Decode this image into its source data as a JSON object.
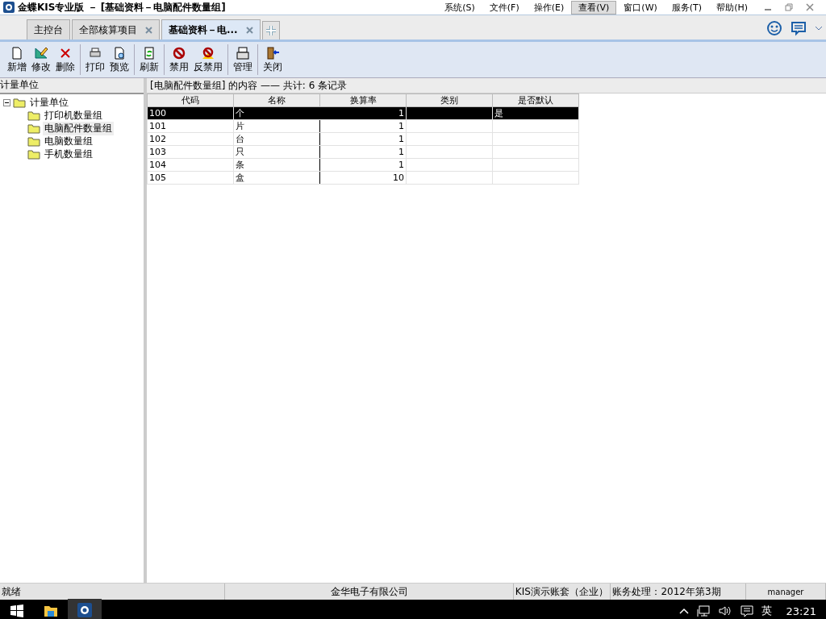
{
  "window": {
    "title": "金蝶KIS专业版 － [基础资料－电脑配件数量组]"
  },
  "menu": [
    {
      "label": "系统(S)",
      "selected": false
    },
    {
      "label": "文件(F)",
      "selected": false
    },
    {
      "label": "操作(E)",
      "selected": false
    },
    {
      "label": "查看(V)",
      "selected": true
    },
    {
      "label": "窗口(W)",
      "selected": false
    },
    {
      "label": "服务(T)",
      "selected": false
    },
    {
      "label": "帮助(H)",
      "selected": false
    }
  ],
  "tabs": [
    {
      "label": "主控台",
      "selected": false,
      "closable": false
    },
    {
      "label": "全部核算项目",
      "selected": false,
      "closable": true
    },
    {
      "label": "基础资料－电...",
      "selected": true,
      "closable": true
    }
  ],
  "toolbar_groups": [
    [
      {
        "label": "新增",
        "kind": "new"
      },
      {
        "label": "修改",
        "kind": "edit"
      },
      {
        "label": "删除",
        "kind": "delete"
      }
    ],
    [
      {
        "label": "打印",
        "kind": "print"
      },
      {
        "label": "预览",
        "kind": "preview"
      }
    ],
    [
      {
        "label": "刷新",
        "kind": "refresh"
      }
    ],
    [
      {
        "label": "禁用",
        "kind": "ban"
      },
      {
        "label": "反禁用",
        "kind": "unban"
      }
    ],
    [
      {
        "label": "管理",
        "kind": "manage"
      }
    ],
    [
      {
        "label": "关闭",
        "kind": "close"
      }
    ]
  ],
  "sidebar": {
    "title": "计量单位",
    "tree": [
      {
        "label": "计量单位",
        "expanded": true,
        "selected": false,
        "children": [
          {
            "label": "打印机数量组",
            "selected": false
          },
          {
            "label": "电脑配件数量组",
            "selected": true
          },
          {
            "label": "电脑数量组",
            "selected": false
          },
          {
            "label": "手机数量组",
            "selected": false
          }
        ]
      }
    ]
  },
  "content": {
    "header": "[电脑配件数量组] 的内容 —— 共计: 6 条记录",
    "columns": [
      "代码",
      "名称",
      "换算率",
      "类别",
      "是否默认"
    ],
    "rows": [
      {
        "cells": [
          "100",
          "个",
          "1",
          "",
          "是"
        ],
        "selected": true
      },
      {
        "cells": [
          "101",
          "片",
          "1",
          "",
          ""
        ],
        "selected": false
      },
      {
        "cells": [
          "102",
          "台",
          "1",
          "",
          ""
        ],
        "selected": false
      },
      {
        "cells": [
          "103",
          "只",
          "1",
          "",
          ""
        ],
        "selected": false
      },
      {
        "cells": [
          "104",
          "条",
          "1",
          "",
          ""
        ],
        "selected": false
      },
      {
        "cells": [
          "105",
          "盒",
          "10",
          "",
          ""
        ],
        "selected": false
      }
    ]
  },
  "status_bar": [
    "就绪",
    "金华电子有限公司",
    "KIS演示账套（企业）",
    "账务处理：2012年第3期",
    "manager"
  ],
  "taskbar": {
    "tray_language": "英",
    "clock": "23:21"
  }
}
